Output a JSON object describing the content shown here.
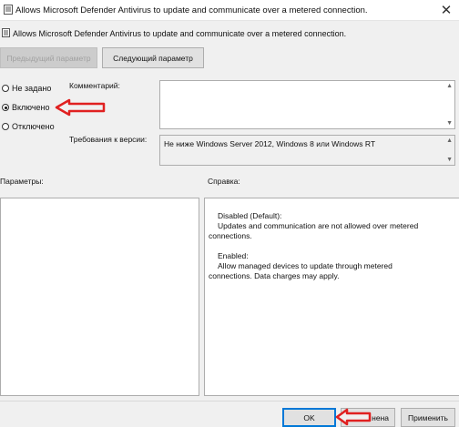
{
  "window": {
    "title": "Allows Microsoft Defender Antivirus to update and communicate over a metered connection.",
    "close_glyph": "✕"
  },
  "header": {
    "setting_name": "Allows Microsoft Defender Antivirus to update and communicate over a metered connection."
  },
  "nav": {
    "prev_label": "Предыдущий параметр",
    "next_label": "Следующий параметр"
  },
  "state": {
    "options": [
      {
        "label": "Не задано",
        "checked": false
      },
      {
        "label": "Включено",
        "checked": true
      },
      {
        "label": "Отключено",
        "checked": false
      }
    ]
  },
  "comment": {
    "label": "Комментарий:",
    "value": ""
  },
  "version": {
    "label": "Требования к версии:",
    "value": "Не ниже Windows Server 2012, Windows 8 или Windows RT"
  },
  "panels": {
    "options_label": "Параметры:",
    "help_label": "Справка:",
    "help_lines": [
      "Disabled (Default):",
      "Updates and communication are not allowed over metered",
      "connections.",
      "",
      "Enabled:",
      "Allow managed devices to update through metered",
      "connections. Data charges may apply."
    ]
  },
  "footer": {
    "ok_label": "OK",
    "cancel_label": "Отмена",
    "cancel_visible": "нена",
    "apply_label": "Применить"
  },
  "colors": {
    "annotation_arrow": "#e02020",
    "primary_border": "#0078d7"
  },
  "icons": {
    "window": "policy-icon",
    "close": "close-icon",
    "arrows": "annotation-arrow-icon"
  }
}
